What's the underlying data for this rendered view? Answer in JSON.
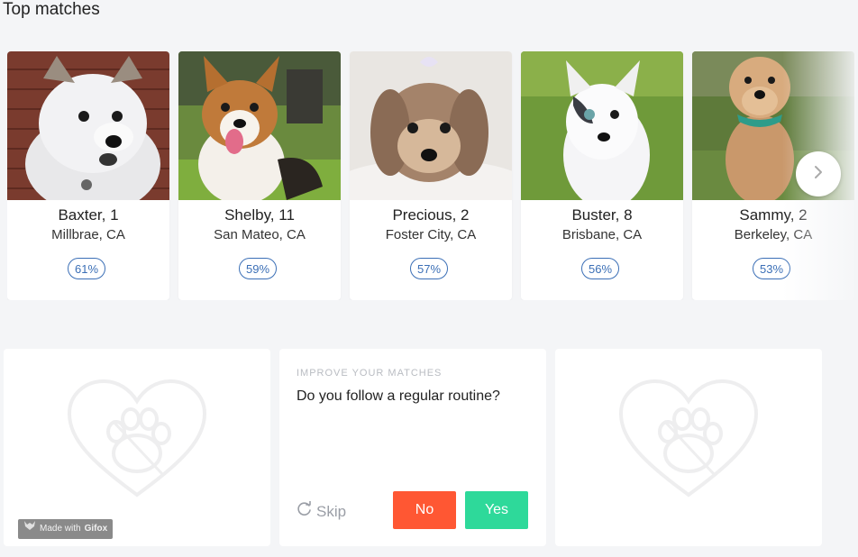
{
  "header": {
    "title": "Top matches"
  },
  "matches": [
    {
      "name": "Baxter, 1",
      "location": "Millbrae, CA",
      "percent": "61%"
    },
    {
      "name": "Shelby, 11",
      "location": "San Mateo, CA",
      "percent": "59%"
    },
    {
      "name": "Precious, 2",
      "location": "Foster City, CA",
      "percent": "57%"
    },
    {
      "name": "Buster, 8",
      "location": "Brisbane, CA",
      "percent": "56%"
    },
    {
      "name": "Sammy, 2",
      "location": "Berkeley, CA",
      "percent": "53%"
    }
  ],
  "improve": {
    "label": "IMPROVE YOUR MATCHES",
    "question": "Do you follow a regular routine?",
    "skip_label": "Skip",
    "no_label": "No",
    "yes_label": "Yes"
  },
  "watermark": {
    "prefix": "Made with",
    "brand": "Gifox"
  },
  "colors": {
    "accent_blue": "#3b6fb6",
    "no_red": "#ff5733",
    "yes_green": "#2ed99a",
    "background": "#f4f5f7"
  },
  "icons": [
    "chevron-right-icon",
    "heart-paw-icon",
    "refresh-icon",
    "fox-icon"
  ]
}
